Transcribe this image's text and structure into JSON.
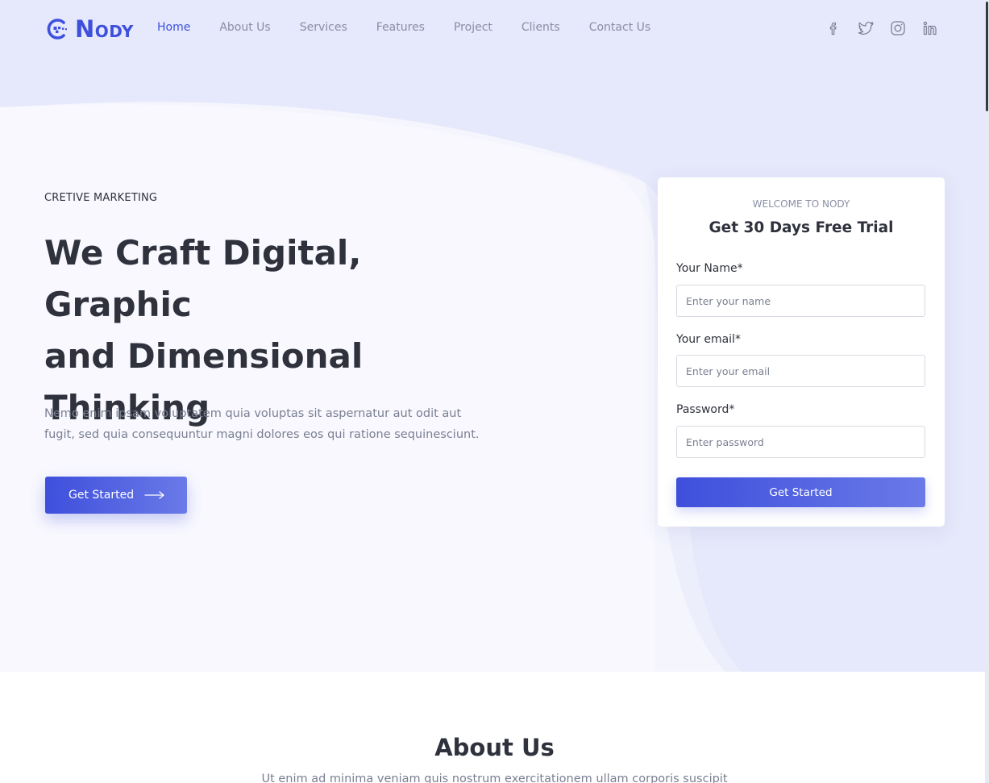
{
  "brand": {
    "logo_initial": "N",
    "logo_rest": "ODY",
    "accent_color": "#3e50dc",
    "hero_bg_color": "#e6e8fb"
  },
  "nav": {
    "items": [
      {
        "label": "Home",
        "active": true
      },
      {
        "label": "About Us"
      },
      {
        "label": "Services"
      },
      {
        "label": "Features"
      },
      {
        "label": "Project"
      },
      {
        "label": "Clients"
      },
      {
        "label": "Contact Us"
      }
    ]
  },
  "socials": [
    {
      "icon": "facebook-icon"
    },
    {
      "icon": "twitter-icon"
    },
    {
      "icon": "instagram-icon"
    },
    {
      "icon": "linkedin-icon"
    }
  ],
  "hero": {
    "eyebrow": "CRETIVE MARKETING",
    "headline_line1": "We Craft Digital, Graphic",
    "headline_line2": "and Dimensional",
    "headline_line3": "Thinking",
    "lead_line1": "Nemo enim ipsam voluptatem quia voluptas sit aspernatur aut odit aut",
    "lead_line2": "fugit, sed quia consequuntur magni dolores eos qui ratione sequinesciunt.",
    "cta_label": "Get Started"
  },
  "signup": {
    "eyebrow": "WELCOME TO NODY",
    "title": "Get 30 Days Free Trial",
    "name_label": "Your Name*",
    "name_placeholder": "Enter your name",
    "email_label": "Your email*",
    "email_placeholder": "Enter your email",
    "password_label": "Password*",
    "password_placeholder": "Enter password",
    "submit_label": "Get Started"
  },
  "about": {
    "title": "About Us",
    "text": "Ut enim ad minima veniam quis nostrum exercitationem ullam corporis suscipit"
  }
}
